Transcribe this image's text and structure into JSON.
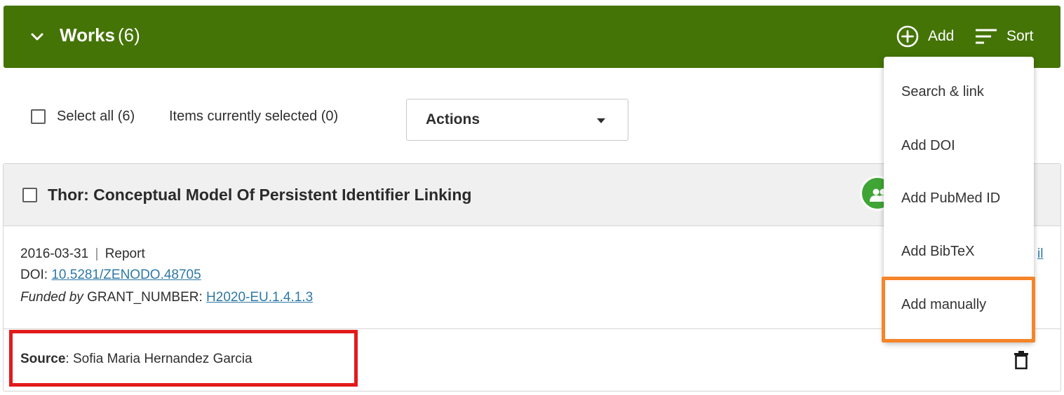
{
  "header": {
    "title": "Works",
    "count": "(6)",
    "add_label": "Add",
    "sort_label": "Sort",
    "bg_color": "#447405"
  },
  "toolbar": {
    "select_all_label": "Select all (6)",
    "items_selected_label": "Items currently selected (0)",
    "actions_label": "Actions"
  },
  "work": {
    "title": "Thor: Conceptual Model Of Persistent Identifier Linking",
    "date": "2016-03-31",
    "separator": "|",
    "type": "Report",
    "doi_label": "DOI:",
    "doi_value": "10.5281/ZENODO.48705",
    "funded_by_label": "Funded by",
    "grant_label": "GRANT_NUMBER:",
    "grant_value": "H2020-EU.1.4.1.3",
    "detail_link_fragment": "il",
    "source_label": "Source",
    "source_value": ": Sofia Maria Hernandez Garcia"
  },
  "add_menu": {
    "items": [
      {
        "label": "Search & link"
      },
      {
        "label": "Add DOI"
      },
      {
        "label": "Add PubMed ID"
      },
      {
        "label": "Add BibTeX"
      },
      {
        "label": "Add manually"
      }
    ]
  },
  "icons": {
    "expand": "chevron-down-icon",
    "add": "plus-circle-icon",
    "sort": "sort-icon",
    "group": "group-icon",
    "delete": "trash-icon"
  },
  "highlights": {
    "source_box_color": "#e21b1b",
    "menu_item_box_color": "#f5852a"
  }
}
